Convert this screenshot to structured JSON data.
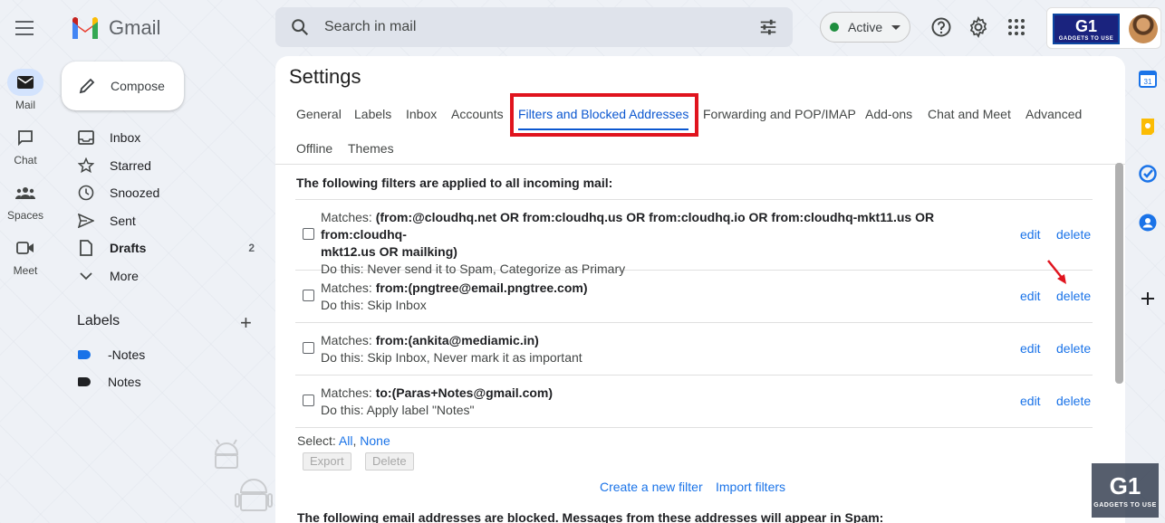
{
  "app": {
    "name": "Gmail"
  },
  "search": {
    "placeholder": "Search in mail"
  },
  "status": {
    "label": "Active",
    "color": "#1e8e3e"
  },
  "brand": {
    "logo": "G1",
    "sub": "GADGETS TO USE"
  },
  "rail": [
    {
      "label": "Mail",
      "icon": "mail-icon"
    },
    {
      "label": "Chat",
      "icon": "chat-icon"
    },
    {
      "label": "Spaces",
      "icon": "spaces-icon"
    },
    {
      "label": "Meet",
      "icon": "meet-icon"
    }
  ],
  "compose": {
    "label": "Compose"
  },
  "nav": [
    {
      "label": "Inbox",
      "icon": "inbox-icon",
      "count": ""
    },
    {
      "label": "Starred",
      "icon": "star-icon",
      "count": ""
    },
    {
      "label": "Snoozed",
      "icon": "clock-icon",
      "count": ""
    },
    {
      "label": "Sent",
      "icon": "send-icon",
      "count": ""
    },
    {
      "label": "Drafts",
      "icon": "draft-icon",
      "count": "2"
    },
    {
      "label": "More",
      "icon": "chevron-down-icon",
      "count": ""
    }
  ],
  "labels": {
    "title": "Labels",
    "items": [
      {
        "label": "-Notes",
        "color": "#1a73e8"
      },
      {
        "label": "Notes",
        "color": "#202124"
      }
    ]
  },
  "settings": {
    "title": "Settings",
    "tabs": [
      "General",
      "Labels",
      "Inbox",
      "Accounts",
      "Filters and Blocked Addresses",
      "Forwarding and POP/IMAP",
      "Add-ons",
      "Chat and Meet",
      "Advanced",
      "Offline",
      "Themes"
    ],
    "active_tab": "Filters and Blocked Addresses",
    "section_heading": "The following filters are applied to all incoming mail:",
    "filters": [
      {
        "matches_prefix": "Matches: ",
        "matches": "(from:@cloudhq.net OR from:cloudhq.us OR from:cloudhq.io OR from:cloudhq-mkt11.us OR from:cloudhq-",
        "matches_line2": "mkt12.us OR mailking)",
        "action": "Do this: Never send it to Spam, Categorize as Primary"
      },
      {
        "matches_prefix": "Matches: ",
        "matches": "from:(pngtree@email.pngtree.com)",
        "matches_line2": "",
        "action": "Do this: Skip Inbox"
      },
      {
        "matches_prefix": "Matches: ",
        "matches": "from:(ankita@mediamic.in)",
        "matches_line2": "",
        "action": "Do this: Skip Inbox, Never mark it as important"
      },
      {
        "matches_prefix": "Matches: ",
        "matches": "to:(Paras+Notes@gmail.com)",
        "matches_line2": "",
        "action": "Do this: Apply label \"Notes\""
      }
    ],
    "edit_label": "edit",
    "delete_label": "delete",
    "select": {
      "prefix": "Select: ",
      "all": "All",
      "sep": ", ",
      "none": "None"
    },
    "export_label": "Export",
    "delete_btn_label": "Delete",
    "create_filter": "Create a new filter",
    "import_filters": "Import filters",
    "cutoff_text": "The following email addresses are blocked. Messages from these addresses will appear in Spam:"
  },
  "watermark": {
    "logo": "G1",
    "sub": "GADGETS TO USE"
  }
}
